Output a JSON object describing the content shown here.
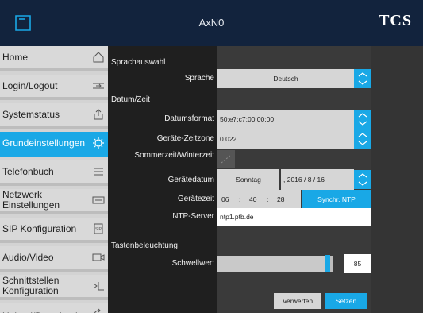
{
  "header": {
    "title": "AxN0",
    "brand": "TCS"
  },
  "sidebar": {
    "items": [
      {
        "label": "Home",
        "icon": "home-icon"
      },
      {
        "label": "Login/Logout",
        "icon": "login-icon"
      },
      {
        "label": "Systemstatus",
        "icon": "export-icon"
      },
      {
        "label": "Grundeinstellungen",
        "icon": "gear-icon",
        "active": true
      },
      {
        "label": "Telefonbuch",
        "icon": "list-icon"
      },
      {
        "label": "Netzwerk Einstellungen",
        "icon": "network-icon"
      },
      {
        "label": "SIP Konfiguration",
        "icon": "sip-icon"
      },
      {
        "label": "Audio/Video",
        "icon": "camera-icon"
      },
      {
        "label": "Schnittstellen Konfiguration",
        "icon": "interface-icon"
      },
      {
        "label": "Upload/Download",
        "icon": "refresh-icon"
      }
    ]
  },
  "settings": {
    "section_language": "Sprachauswahl",
    "language_label": "Sprache",
    "language_value": "Deutsch",
    "section_datetime": "Datum/Zeit",
    "date_format_label": "Datumsformat",
    "date_format_value": "50:e7:c7:00:00:00",
    "timezone_label": "Geräte-Zeitzone",
    "timezone_value": "0.022",
    "dst_label": "Sommerzeit/Winterzeit",
    "device_date_label": "Gerätedatum",
    "device_date_weekday": "Sonntag",
    "device_date_value": ", 2016 / 8 / 16",
    "device_time_label": "Gerätezeit",
    "time_hour": "06",
    "time_sep1": ":",
    "time_minute": "40",
    "time_sep2": ":",
    "time_second": "28",
    "sync_ntp_label": "Synchr. NTP",
    "ntp_server_label": "NTP-Server",
    "ntp_server_value": "ntp1.ptb.de",
    "section_backlight": "Tastenbeleuchtung",
    "threshold_label": "Schwellwert",
    "threshold_value": "85",
    "threshold_fraction": 0.95,
    "discard_label": "Verwerfen",
    "apply_label": "Setzen"
  },
  "colors": {
    "accent": "#19a8e6",
    "header_bg": "#12233d",
    "sidebar_bg": "#d9d9d9"
  }
}
